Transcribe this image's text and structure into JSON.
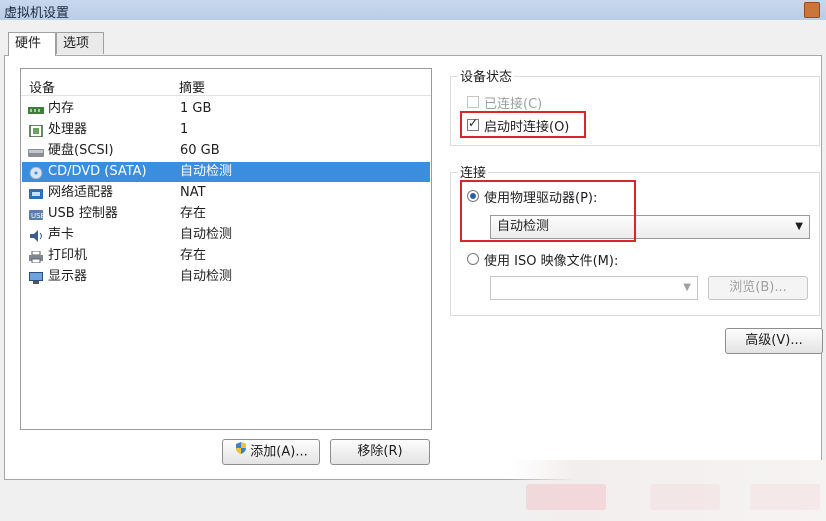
{
  "window": {
    "title": "虚拟机设置"
  },
  "tabs": [
    {
      "label": "硬件",
      "active": true
    },
    {
      "label": "选项",
      "active": false
    }
  ],
  "device_list": {
    "columns": {
      "device": "设备",
      "summary": "摘要"
    },
    "rows": [
      {
        "icon": "memory-icon",
        "name": "内存",
        "summary": "1 GB",
        "selected": false
      },
      {
        "icon": "processor-icon",
        "name": "处理器",
        "summary": "1",
        "selected": false
      },
      {
        "icon": "harddisk-icon",
        "name": "硬盘(SCSI)",
        "summary": "60 GB",
        "selected": false
      },
      {
        "icon": "cd-dvd-icon",
        "name": "CD/DVD (SATA)",
        "summary": "自动检测",
        "selected": true
      },
      {
        "icon": "network-adapter-icon",
        "name": "网络适配器",
        "summary": "NAT",
        "selected": false
      },
      {
        "icon": "usb-icon",
        "name": "USB 控制器",
        "summary": "存在",
        "selected": false
      },
      {
        "icon": "sound-card-icon",
        "name": "声卡",
        "summary": "自动检测",
        "selected": false
      },
      {
        "icon": "printer-icon",
        "name": "打印机",
        "summary": "存在",
        "selected": false
      },
      {
        "icon": "display-icon",
        "name": "显示器",
        "summary": "自动检测",
        "selected": false
      }
    ],
    "add_button": "添加(A)...",
    "remove_button": "移除(R)"
  },
  "device_status": {
    "label": "设备状态",
    "connected": {
      "label": "已连接(C)",
      "checked": false,
      "enabled": false
    },
    "connect_at_power_on": {
      "label": "启动时连接(O)",
      "checked": true,
      "enabled": true
    }
  },
  "connection": {
    "label": "连接",
    "use_physical_drive": {
      "label": "使用物理驱动器(P):",
      "selected": true
    },
    "physical_drive_value": "自动检测",
    "use_iso": {
      "label": "使用 ISO 映像文件(M):",
      "selected": false
    },
    "iso_path_value": "",
    "browse_button": "浏览(B)..."
  },
  "advanced_button": "高级(V)...",
  "colors": {
    "selection": "#3b8ddd",
    "highlight_box": "#d9262a",
    "title_bar": "#c8d8ec"
  }
}
